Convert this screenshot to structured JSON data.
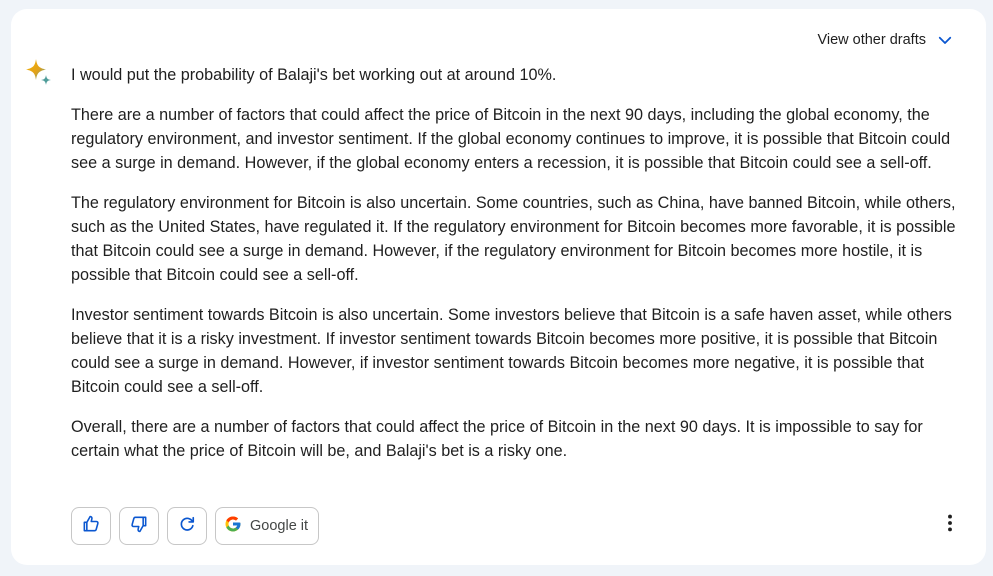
{
  "header": {
    "drafts_label": "View other drafts"
  },
  "response": {
    "paragraphs": [
      "I would put the probability of Balaji's bet working out at around 10%.",
      "There are a number of factors that could affect the price of Bitcoin in the next 90 days, including the global economy, the regulatory environment, and investor sentiment. If the global economy continues to improve, it is possible that Bitcoin could see a surge in demand. However, if the global economy enters a recession, it is possible that Bitcoin could see a sell-off.",
      "The regulatory environment for Bitcoin is also uncertain. Some countries, such as China, have banned Bitcoin, while others, such as the United States, have regulated it. If the regulatory environment for Bitcoin becomes more favorable, it is possible that Bitcoin could see a surge in demand. However, if the regulatory environment for Bitcoin becomes more hostile, it is possible that Bitcoin could see a sell-off.",
      "Investor sentiment towards Bitcoin is also uncertain. Some investors believe that Bitcoin is a safe haven asset, while others believe that it is a risky investment. If investor sentiment towards Bitcoin becomes more positive, it is possible that Bitcoin could see a surge in demand. However, if investor sentiment towards Bitcoin becomes more negative, it is possible that Bitcoin could see a sell-off.",
      "Overall, there are a number of factors that could affect the price of Bitcoin in the next 90 days. It is impossible to say for certain what the price of Bitcoin will be, and Balaji's bet is a risky one."
    ]
  },
  "actions": {
    "google_label": "Google it"
  },
  "icons": {
    "sparkle": "sparkle-icon",
    "chevron": "chevron-down-icon",
    "thumbs_up": "thumbs-up-icon",
    "thumbs_down": "thumbs-down-icon",
    "regenerate": "regenerate-icon",
    "google": "google-g-icon",
    "more": "more-vert-icon"
  },
  "colors": {
    "page_background": "#f0f4f9",
    "card_background": "#ffffff",
    "accent": "#0b57d0",
    "text": "#1f1f1f"
  }
}
